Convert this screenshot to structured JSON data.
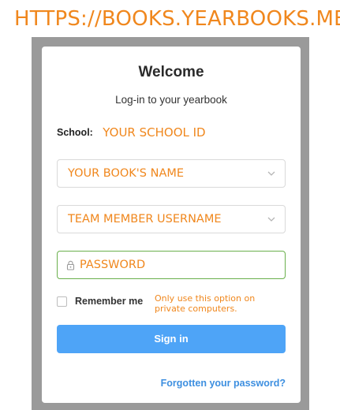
{
  "banner": {
    "url": "HTTPS://BOOKS.YEARBOOKS.ME"
  },
  "login": {
    "title": "Welcome",
    "subtitle": "Log-in to your yearbook",
    "school_label": "School:",
    "school_value": "YOUR SCHOOL ID",
    "book_select_value": "YOUR BOOK'S NAME",
    "username_select_value": "TEAM MEMBER USERNAME",
    "password_value": "PASSWORD",
    "remember_label": "Remember me",
    "remember_checked": false,
    "private_note": "Only use this option on private computers.",
    "signin_label": "Sign in",
    "forgot_label": "Forgotten your password?"
  },
  "colors": {
    "accent_orange": "#f0871d",
    "button_blue": "#4ea4f7",
    "link_blue": "#3d8fe0",
    "valid_green": "#6ab04c",
    "backdrop_gray": "#9a9a9a"
  },
  "icons": {
    "book_select": "chevron-down-icon",
    "username_select": "chevron-down-icon",
    "password": "lock-icon"
  }
}
